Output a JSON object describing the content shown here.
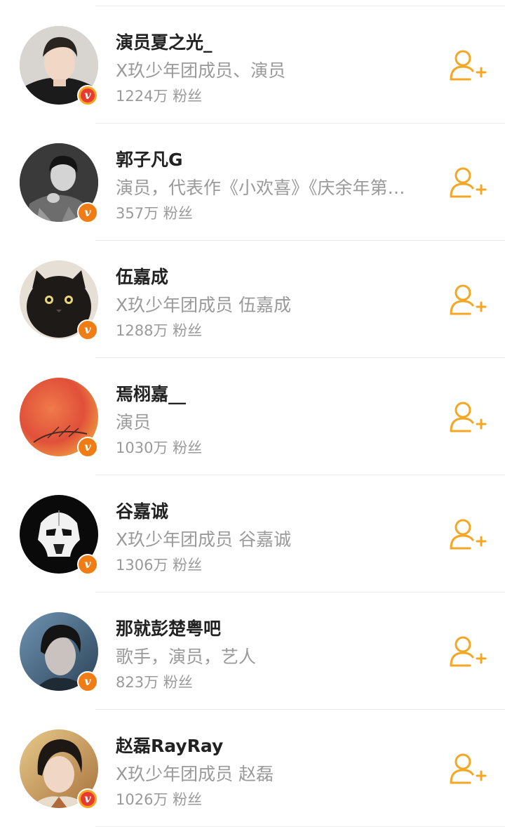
{
  "accent_color": "#f5a623",
  "users": [
    {
      "name": "演员夏之光_",
      "description": "X玖少年团成员、演员",
      "fans_count": "1224万",
      "fans_label": "粉丝",
      "badge_icon": "verified-v-icon",
      "badge_color": "#f5a623",
      "follow_icon": "add-user-icon"
    },
    {
      "name": "郭子凡G",
      "description": "演员，代表作《小欢喜》《庆余年第…",
      "fans_count": "357万",
      "fans_label": "粉丝",
      "badge_icon": "verified-v-icon",
      "badge_color": "#f07c16",
      "follow_icon": "add-user-icon"
    },
    {
      "name": "伍嘉成",
      "description": "X玖少年团成员  伍嘉成",
      "fans_count": "1288万",
      "fans_label": "粉丝",
      "badge_icon": "verified-v-icon",
      "badge_color": "#f07c16",
      "follow_icon": "add-user-icon"
    },
    {
      "name": "焉栩嘉__",
      "description": "演员",
      "fans_count": "1030万",
      "fans_label": "粉丝",
      "badge_icon": "verified-v-icon",
      "badge_color": "#f07c16",
      "follow_icon": "add-user-icon"
    },
    {
      "name": "谷嘉诚",
      "description": "X玖少年团成员  谷嘉诚",
      "fans_count": "1306万",
      "fans_label": "粉丝",
      "badge_icon": "verified-v-icon",
      "badge_color": "#f07c16",
      "follow_icon": "add-user-icon"
    },
    {
      "name": "那就彭楚粤吧",
      "description": "歌手，演员，艺人",
      "fans_count": "823万",
      "fans_label": "粉丝",
      "badge_icon": "verified-v-icon",
      "badge_color": "#f07c16",
      "follow_icon": "add-user-icon"
    },
    {
      "name": "赵磊RayRay",
      "description": "X玖少年团成员 赵磊",
      "fans_count": "1026万",
      "fans_label": "粉丝",
      "badge_icon": "verified-v-icon",
      "badge_color": "#f5a623",
      "follow_icon": "add-user-icon"
    }
  ]
}
